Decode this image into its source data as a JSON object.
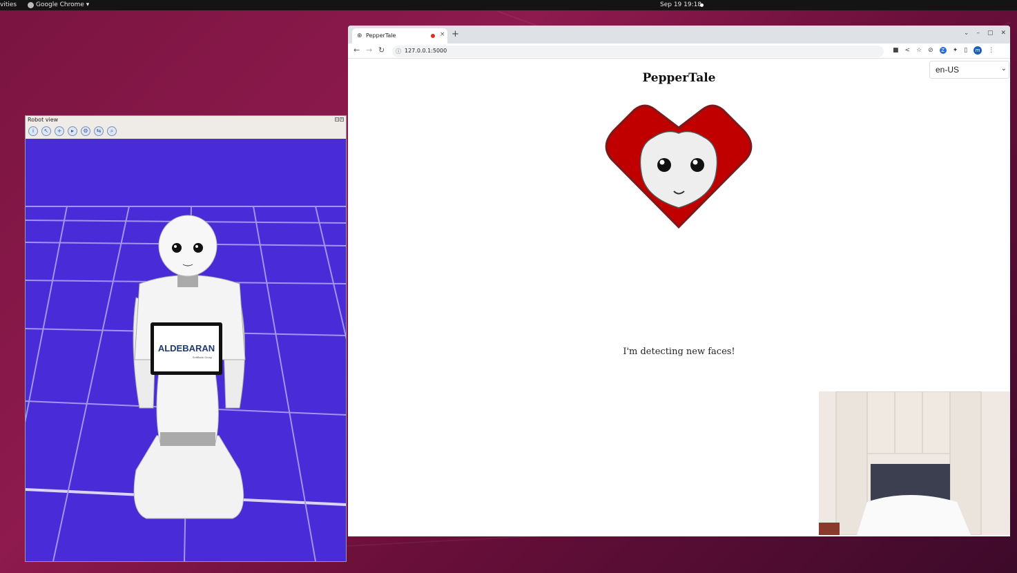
{
  "desktop": {
    "activities_label": "vities",
    "app_menu_label": "Google Chrome ▾",
    "clock": "Sep 19  19:18"
  },
  "robot_view": {
    "title": "Robot view",
    "toolbar_icons": [
      "info-icon",
      "cursor-icon",
      "robot-add-icon",
      "robot-run-icon",
      "robot-settings-icon",
      "robot-connect-icon",
      "robot-search-icon"
    ],
    "colors": {
      "floor": "#4a2bd8",
      "grid": "#b9b0f5"
    },
    "tablet_brand": "ALDEBARAN",
    "tablet_sub": "SoftBank Group"
  },
  "browser": {
    "tab_title": "PepperTale",
    "new_tab_label": "+",
    "url": "127.0.0.1:5000",
    "colors": {
      "tab_strip": "#dee1e6",
      "record_dot": "#d93025",
      "avatar": "#1a5fb4"
    }
  },
  "page": {
    "title": "PepperTale",
    "language_selected": "en-US",
    "status_message": "I'm detecting new faces!",
    "colors": {
      "heart": "#c00000",
      "heart_stroke": "#7a1a1a",
      "face": "#eeeeee"
    }
  }
}
